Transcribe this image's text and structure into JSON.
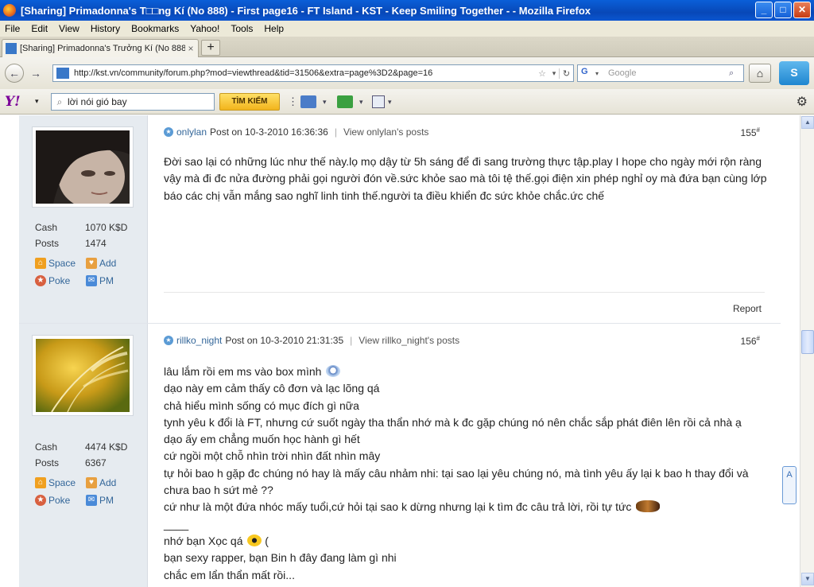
{
  "window": {
    "title": "[Sharing] Primadonna's T□□ng Kí (No 888) - First page16 - FT Island - KST - Keep Smiling Together - - Mozilla Firefox",
    "buttons": {
      "minimize": "_",
      "maximize": "□",
      "close": "✕"
    }
  },
  "menu": [
    "File",
    "Edit",
    "View",
    "History",
    "Bookmarks",
    "Yahoo!",
    "Tools",
    "Help"
  ],
  "tab": {
    "label": "[Sharing] Primadonna's Trưởng Kí (No 888) - ...",
    "close": "×",
    "new_tab": "+"
  },
  "nav": {
    "back": "←",
    "forward": "→",
    "url": "http://kst.vn/community/forum.php?mod=viewthread&tid=31506&extra=page%3D2&page=16",
    "star": "☆",
    "drop": "▾",
    "reload": "↻",
    "search_placeholder": "Google",
    "search_engine": "G",
    "mag": "⌕",
    "home": "⌂",
    "skype": "S"
  },
  "yahoo": {
    "logo": "Y!",
    "drop": "▾",
    "search_value": "lời nói gió bay",
    "search_button": "TÌM KIẾM",
    "mag": "⌕",
    "gear": "⚙"
  },
  "posts": [
    {
      "author": "onlylan",
      "posted": "Post on 10-3-2010 16:36:36",
      "view_link": "View onlylan's posts",
      "number": "155",
      "number_sup": "#",
      "cash_label": "Cash",
      "cash_value": "1070 K$D",
      "posts_label": "Posts",
      "posts_value": "1474",
      "links": {
        "space": "Space",
        "add": "Add",
        "poke": "Poke",
        "pm": "PM"
      },
      "lines": [
        "Đời sao lại có những lúc như thế này.lọ mọ dậy từ 5h sáng để đi sang trường thực tập.play I hope cho ngày mới rộn ràng",
        "vậy mà đi đc nửa đường phải gọi người đón về.sức khỏe sao mà tôi tệ thế.gọi điện xin phép nghỉ oy mà đứa bạn cùng lớp",
        "báo các chị vẫn mắng sao nghĩ linh tinh thế.người ta điều khiển đc sức khỏe chắc.ức chế"
      ],
      "report": "Report"
    },
    {
      "author": "rillko_night",
      "posted": "Post on 10-3-2010 21:31:35",
      "view_link": "View rillko_night's posts",
      "number": "156",
      "number_sup": "#",
      "cash_label": "Cash",
      "cash_value": "4474 K$D",
      "posts_label": "Posts",
      "posts_value": "6367",
      "links": {
        "space": "Space",
        "add": "Add",
        "poke": "Poke",
        "pm": "PM"
      },
      "lines": [
        "lâu lắm rồi em ms vào box mình",
        "dạo này em cảm thấy cô đơn và lạc lõng qá",
        "chả hiểu mình sống có mục đích gì nữa",
        "tynh yêu k đổi là FT, nhưng cứ suốt ngày tha thẩn nhớ mà k đc gặp chúng nó nên chắc sắp phát điên lên rồi cả nhà ạ",
        "dạo ấy em chẳng muốn học hành gì hết",
        "cứ ngồi một chỗ nhìn trời nhìn đất nhìn mây",
        "tự hỏi bao h gặp đc chúng nó hay là mấy câu nhảm nhi: tại sao lại yêu chúng nó, mà tình yêu ấy lại k bao h thay đổi và",
        "chưa bao h sứt mẻ ??",
        "cứ như là một đứa nhóc mấy tuổi,cứ hỏi tại sao k dừng nhưng lại k tìm đc câu trả lời, rồi tự tức",
        "____",
        "nhớ bạn Xọc qá",
        "bạn sexy rapper, bạn Bin h đây đang làm gì nhi",
        "chắc em lẩn thẩn mất rồi..."
      ],
      "sad_suffix": "("
    }
  ],
  "scroll": {
    "up": "▲",
    "down": "▼"
  },
  "side_widget": "A"
}
